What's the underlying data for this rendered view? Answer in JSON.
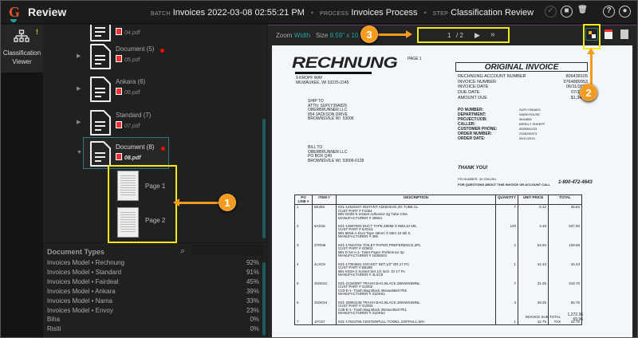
{
  "header": {
    "app_title": "Review",
    "batch_label": "BATCH",
    "batch_value": "Invoices 2022-03-08 02:55:21 PM",
    "process_label": "PROCESS",
    "process_value": "Invoices Process",
    "step_label": "STEP",
    "step_value": "Classification Review",
    "sep": "•",
    "icons": [
      "check-icon",
      "stop-icon",
      "trash-icon",
      "help-icon",
      "user-icon"
    ]
  },
  "rail": {
    "label": "Classification Viewer",
    "alert": "!"
  },
  "tree": {
    "nodes": [
      {
        "name": "",
        "file": "04.pdf",
        "flag": false
      },
      {
        "name": "Document (5)",
        "file": "05.pdf",
        "flag": true
      },
      {
        "name": "Ankara (6)",
        "file": "06.pdf",
        "flag": false
      },
      {
        "name": "Standard (7)",
        "file": "07.pdf",
        "flag": false
      },
      {
        "name": "Document (8)",
        "file": "08.pdf",
        "flag": true
      }
    ],
    "pages": [
      "Page 1",
      "Page 2"
    ]
  },
  "doc_types": {
    "title": "Document Types",
    "items": [
      {
        "name": "Invoices Model • Rechnung",
        "pct": "92%"
      },
      {
        "name": "Invoices Model • Standard",
        "pct": "91%"
      },
      {
        "name": "Invoices Model • Fairdeal",
        "pct": "45%"
      },
      {
        "name": "Invoices Model • Ankara",
        "pct": "39%"
      },
      {
        "name": "Invoices Model • Nama",
        "pct": "33%"
      },
      {
        "name": "Invoices Model • Envoy",
        "pct": "23%"
      },
      {
        "name": "Biha",
        "pct": "0%"
      },
      {
        "name": "Risiti",
        "pct": "0%"
      }
    ]
  },
  "viewer": {
    "zoom_label": "Zoom",
    "zoom_value": "Width",
    "size_label": "Size",
    "size_value": "8.59\" x 10.",
    "page_current": "1",
    "page_total": "/ 2",
    "next": "▶",
    "last": "»"
  },
  "callouts": [
    "1",
    "2",
    "3"
  ],
  "invoice": {
    "brand": "RECHNUNG",
    "page": "PAGE 1",
    "addr": "9 KROPF WAY\nMILWAUKEE, WI 53225-2245",
    "ship_to": "SHIP TO\nATTN: SUPLY39A829\nOBERBRUNNER LLC\n854 JACKSON DRIVE\nBROWNSVILE WI  53006",
    "bill_to": "BILL TO\nOBERBRUNNER LLC\nPO BOX Q49\nBROWNSVILE WI  53006-0128",
    "title": "ORIGINAL INVOICE",
    "head_labels": "RECHNUNG ACCOUNT NUMBER\nINVOICE NUMBER\nINVOICE DATE\nDUE DATE\nAMOUNT DUE",
    "head_values": "806439105\n9764889953\n06/11/2015\n07/11/20\n$1,342.3",
    "po_labels": "PO NUMBER:\nDEPARTMENT:\nPROJECT/JOB:\nCALLER:\nCUSTOMER PHONE:\nORDER NUMBER:\nORDER DATE:",
    "po_values": "SUPLY39A829\nWAREHOUSE\n5644855\nBERKLY SHEEPF\n5555554233\n2348236973\n06/11/2015",
    "thanks": "THANK YOU!",
    "fed": "FEI NUMBER  39-2261391",
    "questions": "FOR QUESTIONS ABOUT THIS INVOICE OR ACCOUNT CALL",
    "phone": "1-800-472-4643",
    "columns": [
      "PO LINE #",
      "ITEM #",
      "DESCRIPTION",
      "QUANTITY",
      "UNIT PRICE",
      "TOTAL"
    ],
    "rows": [
      [
        "1",
        "5E355",
        "K01-14525207 INSTANT ADHESIVE,3G TUBE,CL\nCUST PART # F1004\nBIN G02D-5 Instant Adhesive 3g Tube Clea\nMANUFACTURER # 49504",
        "7",
        "5.12",
        "35.84"
      ],
      [
        "2",
        "5AD15",
        "K01-13997803 DUCT TAPE,48MM X 55M,10 MIL\nCUST PART # 5AD15\nBIN 6E56-A Duct Tape 48mm X 55m 10 Mil S\nMANUFACTURER # 396",
        "120",
        "4.48",
        "537.60"
      ],
      [
        "3",
        "2TRN6",
        "K01-17634704 TOILET PAPER,PREFERENCE,2PL\nCUST PART # G0602\nBIN D 54-A-1- Toilet Paper Preference 2p\nMANUFACTURER # 18280/01",
        "2",
        "54.94",
        "109.88"
      ],
      [
        "4",
        "4LXC8",
        "K01-17354651 SOCKET SET,1/2\" DR,17 PC\nCUST PART # B8289\nBIN K03H-2 Socket Set 1/2 inch  Dr 17 Pc\nMANUFACTURER # 4LXC8",
        "1",
        "44.43",
        "44.43"
      ],
      [
        "5",
        "31DK61",
        "K01-21340987 TRASH BAG,BLACK,36INWX58INL\nCUST PART # G2002\nC03-E-1- Trash Bag Black 36inwx58inl Pk5\nMANUFACTURER # 31DK61",
        "7",
        "31.25",
        "218.75"
      ],
      [
        "6",
        "31DK54",
        "K01-20894136 TRASH BAG,BLACK,30INWX36INL\nCUST PART # G2000\nC05-E-1- Trash Bag Black 30inwx36inl Pk1\nMANUFACTURER # 31DK54",
        "3",
        "28.25",
        "84.75"
      ],
      [
        "7",
        "1FC67",
        "K01-17634706 CENTERPULL TOWEL,SOFPULL,WH",
        "1",
        "42.75",
        "42.75"
      ]
    ],
    "subtotal_label": "INVOICE SUB TOTAL\nTAX",
    "subtotal_values": "1,272.36\n69.96"
  }
}
